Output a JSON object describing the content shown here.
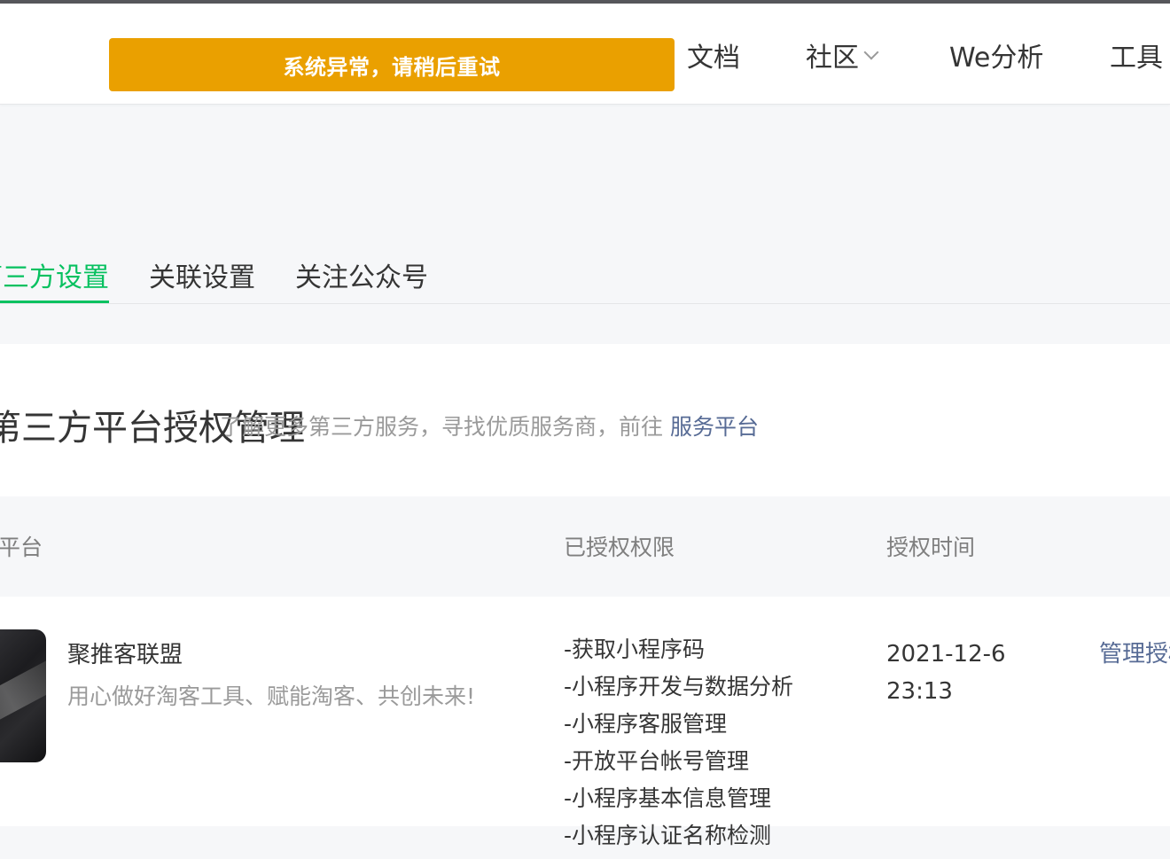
{
  "toast": {
    "message": "系统异常，请稍后重试"
  },
  "nav": {
    "items": [
      {
        "label": "文档"
      },
      {
        "label": "社区"
      },
      {
        "label": "We分析"
      },
      {
        "label": "工具"
      }
    ]
  },
  "tabs": [
    {
      "label": "第三方设置",
      "active": true
    },
    {
      "label": "关联设置",
      "active": false
    },
    {
      "label": "关注公众号",
      "active": false
    }
  ],
  "section": {
    "title": "第三方平台授权管理",
    "desc": "了解更多第三方服务，寻找优质服务商，前往",
    "link": "服务平台"
  },
  "table": {
    "headers": {
      "platform": "授权平台",
      "permissions": "已授权权限",
      "time": "授权时间"
    },
    "rows": [
      {
        "name": "聚推客联盟",
        "slogan": "用心做好淘客工具、赋能淘客、共创未来!",
        "permissions": [
          "-获取小程序码",
          "-小程序开发与数据分析",
          "-小程序客服管理",
          "-开放平台帐号管理",
          "-小程序基本信息管理",
          "-小程序认证名称检测"
        ],
        "date": "2021-12-6",
        "clock": "23:13",
        "action": "管理授权"
      }
    ]
  },
  "colors": {
    "accent": "#07c160",
    "link": "#576b95",
    "toast": "#eaa000"
  }
}
